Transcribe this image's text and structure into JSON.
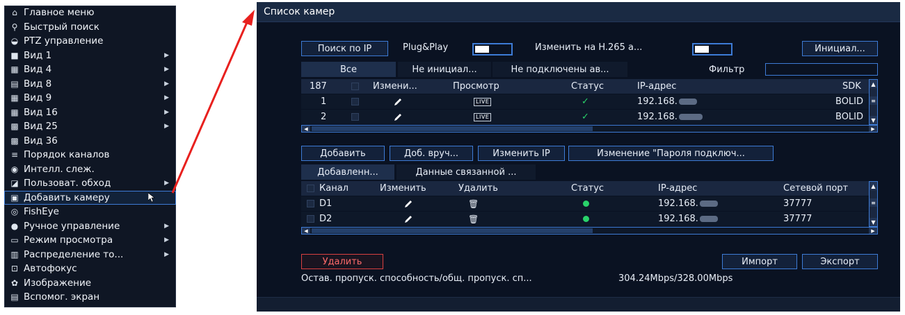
{
  "menu": {
    "items": [
      {
        "icon": "home-icon",
        "glyph": "⌂",
        "label": "Главное меню",
        "submenu": false
      },
      {
        "icon": "search-icon",
        "glyph": "⚲",
        "label": "Быстрый поиск",
        "submenu": false
      },
      {
        "icon": "ptz-icon",
        "glyph": "◒",
        "label": "PTZ управление",
        "submenu": false
      },
      {
        "icon": "view-1-icon",
        "glyph": "■",
        "label": "Вид 1",
        "submenu": true
      },
      {
        "icon": "view-4-icon",
        "glyph": "▦",
        "label": "Вид 4",
        "submenu": true
      },
      {
        "icon": "view-8-icon",
        "glyph": "▤",
        "label": "Вид 8",
        "submenu": true
      },
      {
        "icon": "view-9-icon",
        "glyph": "▦",
        "label": "Вид 9",
        "submenu": true
      },
      {
        "icon": "view-16-icon",
        "glyph": "▦",
        "label": "Вид 16",
        "submenu": true
      },
      {
        "icon": "view-25-icon",
        "glyph": "▩",
        "label": "Вид 25",
        "submenu": true
      },
      {
        "icon": "view-36-icon",
        "glyph": "▩",
        "label": "Вид 36",
        "submenu": false
      },
      {
        "icon": "channel-order-icon",
        "glyph": "≡",
        "label": "Порядок каналов",
        "submenu": false
      },
      {
        "icon": "smart-track-icon",
        "glyph": "◉",
        "label": "Интелл. слеж.",
        "submenu": false
      },
      {
        "icon": "tour-icon",
        "glyph": "◪",
        "label": "Пользоват. обход",
        "submenu": true
      },
      {
        "icon": "add-camera-icon",
        "glyph": "▣",
        "label": "Добавить камеру",
        "submenu": false,
        "active": true
      },
      {
        "icon": "fisheye-icon",
        "glyph": "◎",
        "label": "FishEye",
        "submenu": false
      },
      {
        "icon": "manual-control-icon",
        "glyph": "●",
        "label": "Ручное управление",
        "submenu": true
      },
      {
        "icon": "view-mode-icon",
        "glyph": "▭",
        "label": "Режим просмотра",
        "submenu": true
      },
      {
        "icon": "distribution-icon",
        "glyph": "▥",
        "label": "Распределение то...",
        "submenu": true
      },
      {
        "icon": "autofocus-icon",
        "glyph": "⊡",
        "label": "Автофокус",
        "submenu": false
      },
      {
        "icon": "image-icon",
        "glyph": "✿",
        "label": "Изображение",
        "submenu": false
      },
      {
        "icon": "aux-screen-icon",
        "glyph": "▤",
        "label": "Вспомог. экран",
        "submenu": false
      }
    ]
  },
  "window": {
    "title": "Список камер",
    "search_ip": "Поиск по IP",
    "plug_play": "Plug&Play",
    "h265": "Изменить на H.265 а...",
    "initialize": "Инициал...",
    "tabs_top": [
      "Все",
      "Не инициал...",
      "Не подключены ав..."
    ],
    "filter_label": "Фильтр",
    "top_table": {
      "columns": [
        "187",
        "Измени...",
        "Просмотр",
        "Статус",
        "IP-адрес",
        "SDK"
      ],
      "rows": [
        {
          "num": "1",
          "live": "LIVE",
          "ip": "192.168.",
          "sdk": "BOLID"
        },
        {
          "num": "2",
          "live": "LIVE",
          "ip": "192.168.",
          "sdk": "BOLID"
        }
      ]
    },
    "actions": {
      "add": "Добавить",
      "manual_add": "Доб. вруч...",
      "modify_ip": "Изменить IP",
      "change_password": "Изменение \"Пароля подключ..."
    },
    "tabs_bottom": [
      "Добавленн...",
      "Данные связанной ..."
    ],
    "bottom_table": {
      "columns": [
        "Канал",
        "Изменить",
        "Удалить",
        "Статус",
        "IP-адрес",
        "Сетевой порт"
      ],
      "rows": [
        {
          "channel": "D1",
          "ip": "192.168.",
          "port": "37777"
        },
        {
          "channel": "D2",
          "ip": "192.168.",
          "port": "37777"
        }
      ]
    },
    "delete": "Удалить",
    "import": "Импорт",
    "export": "Экспорт",
    "bandwidth_label": "Остав. пропуск. способность/общ. пропуск. сп...",
    "bandwidth_value": "304.24Mbps/328.00Mbps"
  },
  "colors": {
    "accent": "#3d7bd6",
    "arrow": "#e8201e",
    "status_ok": "#29d36a",
    "delete": "#d94040"
  }
}
